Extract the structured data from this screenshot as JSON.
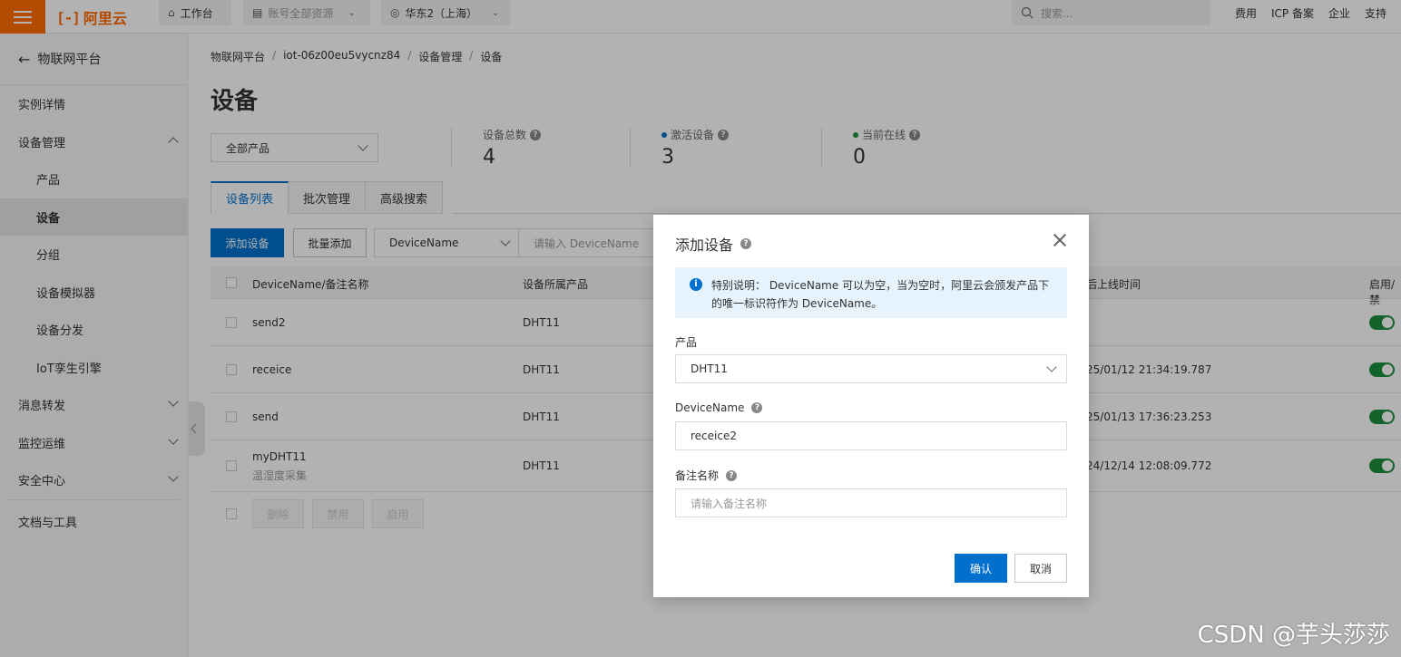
{
  "topbar": {
    "logo_text": "阿里云",
    "nav": [
      {
        "label": "工作台",
        "icon": "home-icon"
      },
      {
        "label": "账号全部资源",
        "icon": "resource-icon"
      },
      {
        "label": "华东2（上海）",
        "icon": "location-icon"
      }
    ],
    "search_placeholder": "搜索...",
    "links": [
      "费用",
      "ICP 备案",
      "企业",
      "支持"
    ]
  },
  "sidebar": {
    "back_label": "物联网平台",
    "items": [
      {
        "label": "实例详情"
      },
      {
        "label": "设备管理"
      },
      {
        "label": "产品"
      },
      {
        "label": "设备"
      },
      {
        "label": "分组"
      },
      {
        "label": "设备模拟器"
      },
      {
        "label": "设备分发"
      },
      {
        "label": "IoT孪生引擎"
      },
      {
        "label": "消息转发"
      },
      {
        "label": "监控运维"
      },
      {
        "label": "安全中心"
      },
      {
        "label": "文档与工具"
      }
    ]
  },
  "breadcrumb": [
    "物联网平台",
    "iot-06z00eu5vycnz84",
    "设备管理",
    "设备"
  ],
  "page_title": "设备",
  "product_filter": "全部产品",
  "stats": [
    {
      "label": "设备总数",
      "value": "4",
      "dot_color": ""
    },
    {
      "label": "激活设备",
      "value": "3",
      "dot_color": "#0070cc"
    },
    {
      "label": "当前在线",
      "value": "0",
      "dot_color": "#1e8e3e"
    }
  ],
  "tabs": [
    "设备列表",
    "批次管理",
    "高级搜索"
  ],
  "toolbar": {
    "add_device": "添加设备",
    "batch_add": "批量添加",
    "filter_field": "DeviceName",
    "filter_placeholder": "请输入 DeviceName"
  },
  "table": {
    "columns": [
      "DeviceName/备注名称",
      "设备所属产品",
      "后上线时间",
      "启用/禁"
    ],
    "rows": [
      {
        "name": "send2",
        "note": "",
        "product": "DHT11",
        "last_online": "",
        "enabled": true
      },
      {
        "name": "receice",
        "note": "",
        "product": "DHT11",
        "last_online": "25/01/12 21:34:19.787",
        "enabled": true
      },
      {
        "name": "send",
        "note": "",
        "product": "DHT11",
        "last_online": "25/01/13 17:36:23.253",
        "enabled": true
      },
      {
        "name": "myDHT11",
        "note": "温湿度采集",
        "product": "DHT11",
        "last_online": "24/12/14 12:08:09.772",
        "enabled": true
      }
    ],
    "footer_buttons": [
      "删除",
      "禁用",
      "启用"
    ]
  },
  "modal": {
    "title": "添加设备",
    "notice": "特别说明： DeviceName 可以为空，当为空时，阿里云会颁发产品下的唯一标识符作为 DeviceName。",
    "product_label": "产品",
    "product_value": "DHT11",
    "devicename_label": "DeviceName",
    "devicename_value": "receice2",
    "note_label": "备注名称",
    "note_placeholder": "请输入备注名称",
    "confirm": "确认",
    "cancel": "取消"
  },
  "watermark": "CSDN @芋头莎莎",
  "colors": {
    "brand": "#ff6a00",
    "primary": "#0070cc",
    "success": "#1e8e3e"
  }
}
